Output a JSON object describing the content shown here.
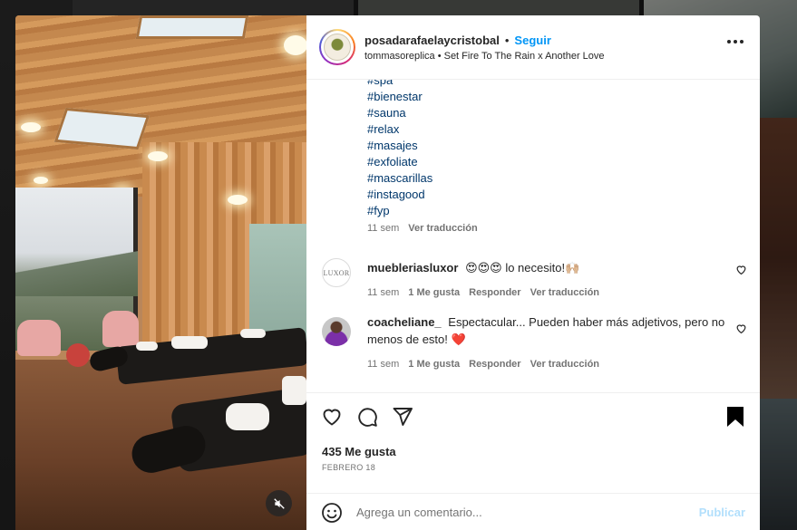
{
  "post": {
    "username": "posadarafaelaycristobal",
    "separator": "•",
    "follow_label": "Seguir",
    "audio": "tommasoreplica • Set Fire To The Rain x Another Love",
    "hashtags": [
      "#spa",
      "#bienestar",
      "#sauna",
      "#relax",
      "#masajes",
      "#exfoliate",
      "#mascarillas",
      "#instagood",
      "#fyp"
    ],
    "caption_time": "11 sem",
    "caption_translate": "Ver traducción",
    "likes": "435 Me gusta",
    "date": "FEBRERO 18"
  },
  "comments": [
    {
      "avatar_text": "LUXOR",
      "username": "muebleriasluxor",
      "text": "😍😍😍 lo necesito!🙌🏼",
      "time": "11 sem",
      "likes": "1 Me gusta",
      "reply": "Responder",
      "translate": "Ver traducción"
    },
    {
      "username": "coacheliane_",
      "text": "Espectacular... Pueden haber más adjetivos, pero no menos de esto! ❤️",
      "time": "11 sem",
      "likes": "1 Me gusta",
      "reply": "Responder",
      "translate": "Ver traducción"
    }
  ],
  "composer": {
    "placeholder": "Agrega un comentario...",
    "publish_label": "Publicar"
  },
  "icons": {
    "header_more": "more-horizontal-icon",
    "like": "heart-outline-icon",
    "comment": "comment-bubble-icon",
    "share": "send-paper-plane-icon",
    "save": "bookmark-filled-icon",
    "emoji": "smiley-icon",
    "mute": "speaker-muted-icon"
  },
  "colors": {
    "accent": "#0095f6",
    "hashtag": "#00376b",
    "muted_text": "#737373",
    "publish_disabled": "#b2dffc"
  }
}
